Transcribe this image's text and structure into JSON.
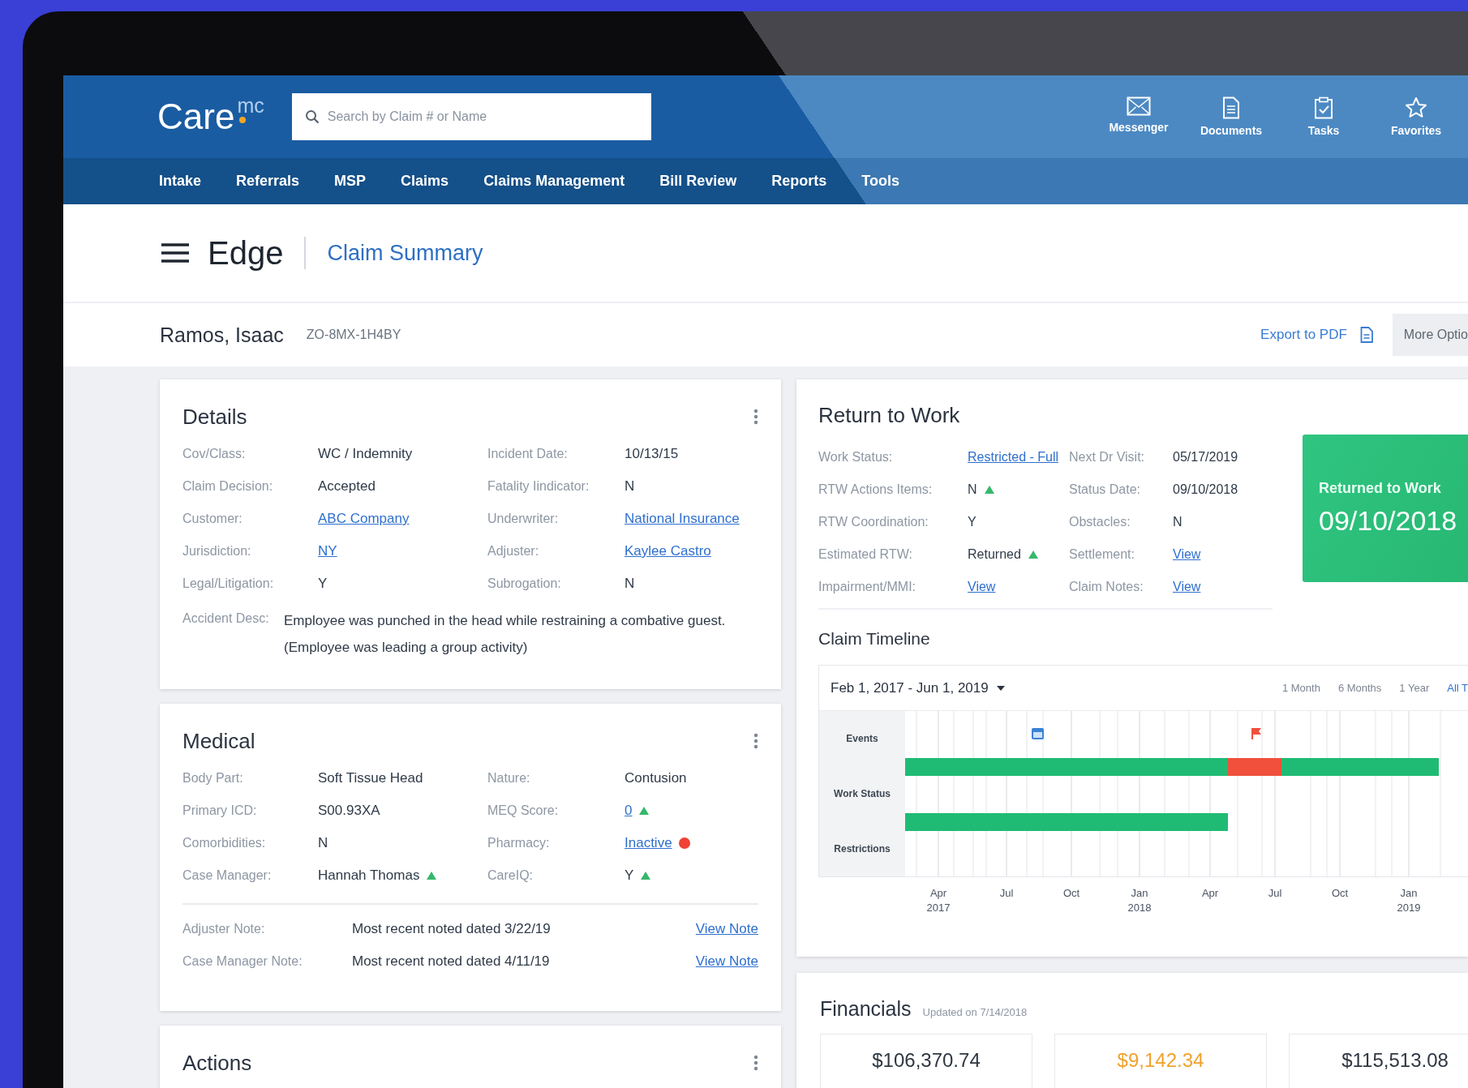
{
  "header": {
    "logo": {
      "text": "Care",
      "superscript": "mc"
    },
    "search": {
      "placeholder": "Search by Claim # or Name"
    },
    "shortcuts": [
      {
        "label": "Messenger"
      },
      {
        "label": "Documents"
      },
      {
        "label": "Tasks"
      },
      {
        "label": "Favorites"
      }
    ]
  },
  "nav": [
    "Intake",
    "Referrals",
    "MSP",
    "Claims",
    "Claims Management",
    "Bill Review",
    "Reports",
    "Tools"
  ],
  "page_title": {
    "app": "Edge",
    "section": "Claim Summary"
  },
  "claimant": {
    "name": "Ramos, Isaac",
    "claim_number": "ZO-8MX-1H4BY",
    "export": "Export to PDF",
    "more": "More Optio"
  },
  "details": {
    "title": "Details",
    "fields": [
      {
        "label": "Cov/Class:",
        "value": "WC / Indemnity",
        "kind": "text"
      },
      {
        "label": "Incident Date:",
        "value": "10/13/15",
        "kind": "text"
      },
      {
        "label": "Claim Decision:",
        "value": "Accepted",
        "kind": "text"
      },
      {
        "label": "Fatality Iindicator:",
        "value": "N",
        "kind": "text"
      },
      {
        "label": "Customer:",
        "value": "ABC Company",
        "kind": "link"
      },
      {
        "label": "Underwriter:",
        "value": "National Insurance",
        "kind": "link"
      },
      {
        "label": "Jurisdiction:",
        "value": "NY",
        "kind": "link"
      },
      {
        "label": "Adjuster:",
        "value": "Kaylee Castro",
        "kind": "link"
      },
      {
        "label": "Legal/Litigation:",
        "value": "Y",
        "kind": "text"
      },
      {
        "label": "Subrogation:",
        "value": "N",
        "kind": "text"
      }
    ],
    "description": {
      "label": "Accident Desc:",
      "text": "Employee was punched in the head while restraining a combative guest. (Employee was leading a group activity)"
    }
  },
  "medical": {
    "title": "Medical",
    "fields": [
      {
        "label": "Body Part:",
        "value": "Soft Tissue Head",
        "kind": "text"
      },
      {
        "label": "Nature:",
        "value": "Contusion",
        "kind": "text"
      },
      {
        "label": "Primary ICD:",
        "value": "S00.93XA",
        "kind": "text"
      },
      {
        "label": "MEQ Score:",
        "value": "0",
        "kind": "link",
        "trend_up": true
      },
      {
        "label": "Comorbidities:",
        "value": "N",
        "kind": "text"
      },
      {
        "label": "Pharmacy:",
        "value": "Inactive",
        "kind": "link",
        "alert": true
      },
      {
        "label": "Case Manager:",
        "value": "Hannah Thomas",
        "kind": "text",
        "trend_up": true
      },
      {
        "label": "CareIQ:",
        "value": "Y",
        "kind": "text",
        "trend_up": true
      }
    ],
    "notes": [
      {
        "label": "Adjuster Note:",
        "text": "Most recent noted dated 3/22/19",
        "link": "View Note"
      },
      {
        "label": "Case Manager Note:",
        "text": "Most recent noted dated 4/11/19",
        "link": "View Note"
      }
    ]
  },
  "actions": {
    "title": "Actions"
  },
  "return_to_work": {
    "title": "Return to Work",
    "fields": [
      {
        "label": "Work Status:",
        "value": "Restricted - Full",
        "kind": "link"
      },
      {
        "label": "Next Dr Visit:",
        "value": "05/17/2019",
        "kind": "text"
      },
      {
        "label": "RTW Actions Items:",
        "value": "N",
        "kind": "text",
        "trend_up": true
      },
      {
        "label": "Status Date:",
        "value": "09/10/2018",
        "kind": "text"
      },
      {
        "label": "RTW Coordination:",
        "value": "Y",
        "kind": "text"
      },
      {
        "label": "Obstacles:",
        "value": "N",
        "kind": "text"
      },
      {
        "label": "Estimated RTW:",
        "value": "Returned",
        "kind": "text",
        "trend_up": true
      },
      {
        "label": "Settlement:",
        "value": "View",
        "kind": "link"
      },
      {
        "label": "Impairment/MMI:",
        "value": "View",
        "kind": "link"
      },
      {
        "label": "Claim Notes:",
        "value": "View",
        "kind": "link"
      }
    ],
    "banner": {
      "label": "Returned to Work",
      "date": "09/10/2018"
    },
    "timeline": {
      "title": "Claim Timeline",
      "range": "Feb 1, 2017 - Jun 1, 2019",
      "ranges": [
        {
          "label": "1 Month",
          "selected": false
        },
        {
          "label": "6 Months",
          "selected": false
        },
        {
          "label": "1 Year",
          "selected": false
        },
        {
          "label": "All T",
          "selected": true
        }
      ],
      "rows": [
        "Events",
        "Work Status",
        "Restrictions"
      ],
      "axis": [
        {
          "month": "Apr",
          "year": "2017"
        },
        {
          "month": "Jul"
        },
        {
          "month": "Oct"
        },
        {
          "month": "Jan",
          "year": "2018"
        },
        {
          "month": "Apr"
        },
        {
          "month": "Jul"
        },
        {
          "month": "Oct"
        },
        {
          "month": "Jan",
          "year": "2019"
        }
      ]
    }
  },
  "financials": {
    "title": "Financials",
    "updated": "Updated on 7/14/2018",
    "amounts": [
      {
        "value": "$106,370.74",
        "color": "#2f3742"
      },
      {
        "value": "$9,142.34",
        "color": "#f0a22e"
      },
      {
        "value": "$115,513.08",
        "color": "#2f3742"
      }
    ]
  }
}
